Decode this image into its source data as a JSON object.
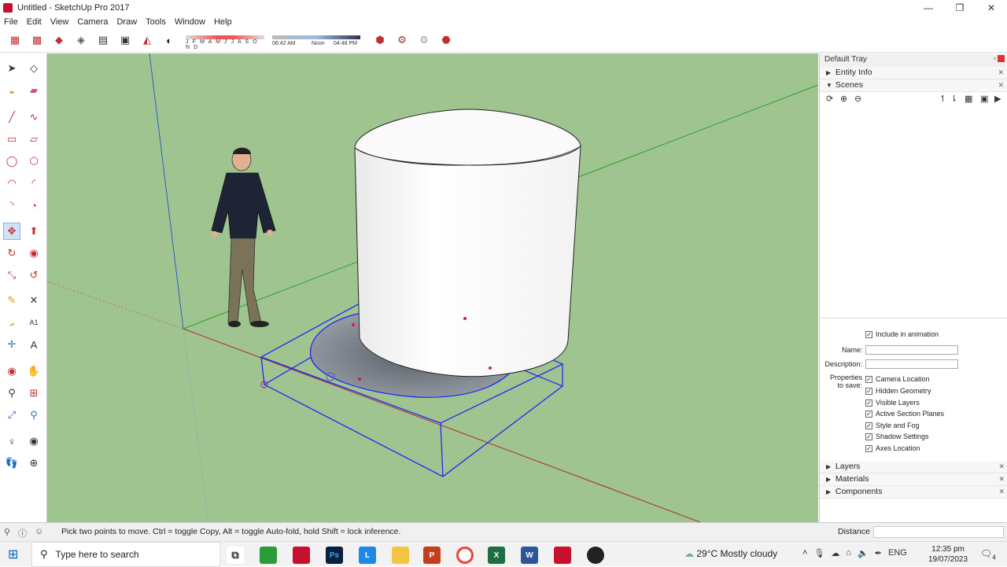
{
  "window": {
    "title": "Untitled - SketchUp Pro 2017"
  },
  "menu": [
    "File",
    "Edit",
    "View",
    "Camera",
    "Draw",
    "Tools",
    "Window",
    "Help"
  ],
  "toolbar": {
    "months": "J F M A M J J A S O N D",
    "time_start": "06:42 AM",
    "time_noon": "Noon",
    "time_end": "04:48 PM"
  },
  "tray": {
    "title": "Default Tray",
    "panels": {
      "entity_info": "Entity Info",
      "scenes": "Scenes",
      "layers": "Layers",
      "materials": "Materials",
      "components": "Components"
    },
    "scene_props": {
      "include_in_animation": "Include in animation",
      "name_label": "Name:",
      "description_label": "Description:",
      "properties_label_1": "Properties",
      "properties_label_2": "to save:",
      "options": [
        "Camera Location",
        "Hidden Geometry",
        "Visible Layers",
        "Active Section Planes",
        "Style and Fog",
        "Shadow Settings",
        "Axes Location"
      ],
      "name_value": "",
      "description_value": ""
    }
  },
  "status": {
    "hint": "Pick two points to move.  Ctrl = toggle Copy, Alt = toggle Auto-fold, hold Shift = lock inference.",
    "distance_label": "Distance",
    "distance_value": ""
  },
  "taskbar": {
    "search_placeholder": "Type here to search",
    "weather": "29°C  Mostly cloudy",
    "language": "ENG",
    "time": "12:35 pm",
    "date": "19/07/2023",
    "notification_count": "4"
  },
  "colors": {
    "viewport": "#9fc490",
    "selection": "#1a1aff",
    "accent": "#c8102e"
  }
}
